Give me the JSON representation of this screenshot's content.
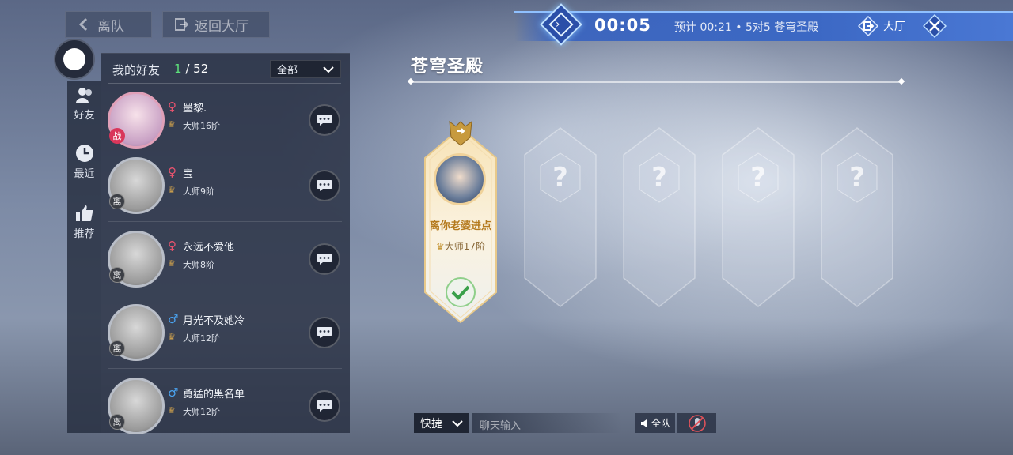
{
  "top_nav": {
    "leave_team": "离队",
    "back_to_lobby": "返回大厅"
  },
  "timer": {
    "elapsed": "00:05",
    "info": "预计 00:21 • 5对5 苍穹圣殿",
    "hall_label": "大厅"
  },
  "sidebar": {
    "items": [
      {
        "label": "好友",
        "icon": "friends-icon"
      },
      {
        "label": "最近",
        "icon": "clock-icon"
      },
      {
        "label": "推荐",
        "icon": "thumbs-up-icon"
      }
    ]
  },
  "friends": {
    "title": "我的好友",
    "online_count": "1",
    "total_count": "/ 52",
    "filter": "全部",
    "list": [
      {
        "name": "墨黎.",
        "gender": "female",
        "gender_symbol": "♀",
        "rank": "大师16阶",
        "status": "online",
        "badge": "战"
      },
      {
        "name": "宝",
        "gender": "female",
        "gender_symbol": "♀",
        "rank": "大师9阶",
        "status": "offline",
        "badge": "离"
      },
      {
        "name": "永远不爱他",
        "gender": "female",
        "gender_symbol": "♀",
        "rank": "大师8阶",
        "status": "offline",
        "badge": "离"
      },
      {
        "name": "月光不及她冷",
        "gender": "male",
        "gender_symbol": "♂",
        "rank": "大师12阶",
        "status": "offline",
        "badge": "离"
      },
      {
        "name": "勇猛的黑名单",
        "gender": "male",
        "gender_symbol": "♂",
        "rank": "大师12阶",
        "status": "offline",
        "badge": "离"
      }
    ]
  },
  "room": {
    "title": "苍穹圣殿",
    "player": {
      "name": "离你老婆进点",
      "rank": "大师17阶"
    },
    "empty_slot_symbol": "?"
  },
  "chat": {
    "quick_label": "快捷",
    "input_placeholder": "聊天输入",
    "team_label": "全队"
  },
  "colors": {
    "accent_blue": "#3c68c4",
    "online_green": "#5de07a",
    "female_pink": "#e8536e",
    "male_blue": "#4aa3f0",
    "player_gold": "#b57a1e"
  }
}
